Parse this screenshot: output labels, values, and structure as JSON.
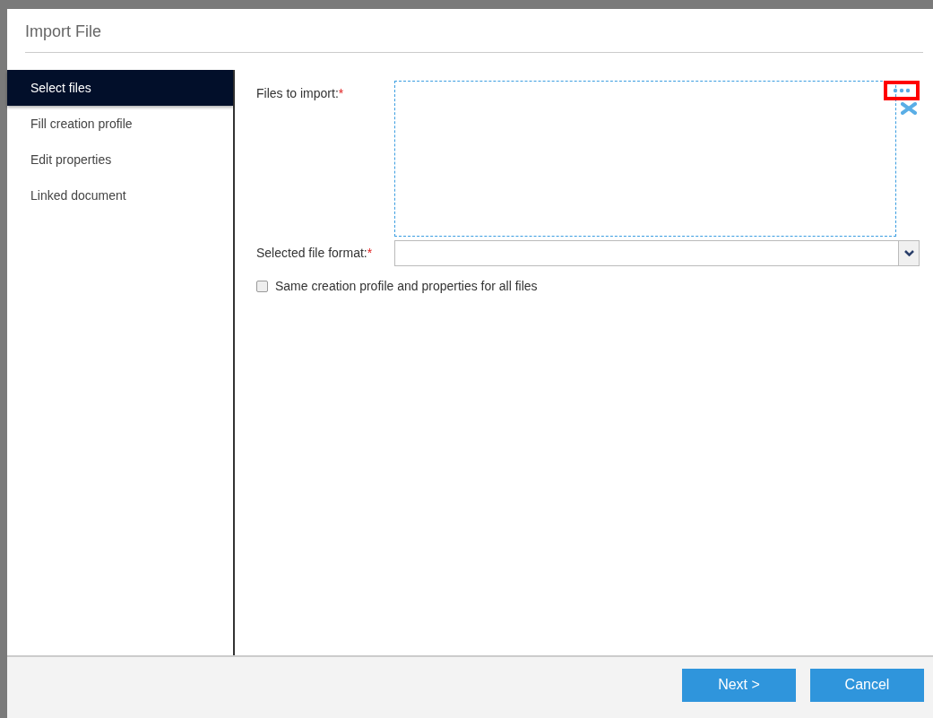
{
  "dialog": {
    "title": "Import File"
  },
  "steps": [
    {
      "label": "Select files",
      "selected": true
    },
    {
      "label": "Fill creation profile",
      "selected": false
    },
    {
      "label": "Edit properties",
      "selected": false
    },
    {
      "label": "Linked document",
      "selected": false
    }
  ],
  "files_field": {
    "label": "Files to import:",
    "required_mark": "*",
    "browse_highlighted": true
  },
  "format_field": {
    "label": "Selected file format:",
    "required_mark": "*"
  },
  "same_profile": {
    "label": "Same creation profile and properties for all files",
    "checked": false
  },
  "buttons": [
    {
      "label": "Next >"
    },
    {
      "label": "Cancel"
    }
  ]
}
